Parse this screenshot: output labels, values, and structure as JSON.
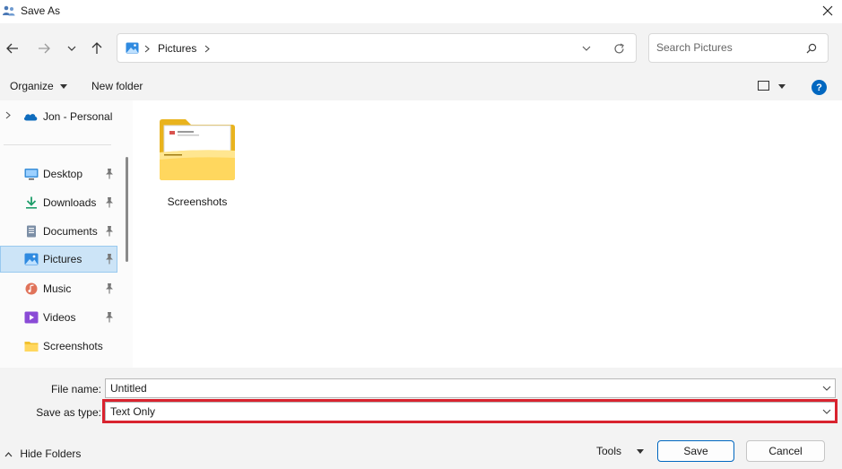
{
  "window": {
    "title": "Save As",
    "icon": "save-as-icon"
  },
  "nav": {
    "back_icon": "arrow-left-icon",
    "forward_icon": "arrow-right-icon",
    "recent_icon": "chevron-down-icon",
    "up_icon": "arrow-up-icon",
    "address_path": "Pictures",
    "refresh_icon": "refresh-icon",
    "search_placeholder": "Search Pictures"
  },
  "toolbar": {
    "organize": "Organize",
    "new_folder": "New folder",
    "help": "?"
  },
  "sidebar": {
    "onedrive": "Jon - Personal",
    "items": [
      {
        "label": "Desktop",
        "icon": "desktop-icon",
        "pinned": true
      },
      {
        "label": "Downloads",
        "icon": "download-icon",
        "pinned": true
      },
      {
        "label": "Documents",
        "icon": "documents-icon",
        "pinned": true
      },
      {
        "label": "Pictures",
        "icon": "pictures-icon",
        "pinned": true,
        "selected": true
      },
      {
        "label": "Music",
        "icon": "music-icon",
        "pinned": true
      },
      {
        "label": "Videos",
        "icon": "videos-icon",
        "pinned": true
      },
      {
        "label": "Screenshots",
        "icon": "folder-icon",
        "pinned": false
      }
    ]
  },
  "content": {
    "folders": [
      {
        "name": "Screenshots"
      }
    ]
  },
  "form": {
    "file_name_label": "File name:",
    "file_name_value": "Untitled",
    "save_type_label": "Save as type:",
    "save_type_value": "Text Only"
  },
  "footer": {
    "hide_folders": "Hide Folders",
    "tools": "Tools",
    "save": "Save",
    "cancel": "Cancel"
  },
  "colors": {
    "accent": "#0067c0",
    "highlight": "#d9232f",
    "selection": "#cce4f7"
  }
}
